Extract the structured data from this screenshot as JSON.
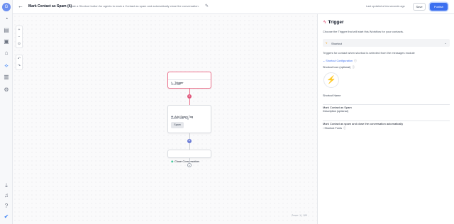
{
  "rail": {
    "logo_letter": "G",
    "icons": [
      "dashboard-icon",
      "conversations-icon",
      "contacts-icon",
      "opportunities-icon",
      "automation-icon",
      "reporting-icon",
      "settings-icon"
    ],
    "bottom_icons": [
      "download-icon",
      "notifications-icon",
      "help-icon",
      "profile-icon"
    ]
  },
  "header": {
    "title": "Mark Contact as Spam (4)",
    "description": "Create a Shortcut button for agents to mark a Contact as spam and automatically close the conversation.",
    "updated_text": "Last updated a few seconds ago",
    "save_label": "Save",
    "publish_label": "Publish"
  },
  "canvas": {
    "zoom_readout": "Zoom: 1 | 100",
    "controls": [
      "+",
      "−",
      "⊙",
      "↶",
      "↷"
    ],
    "nodes": {
      "trigger": {
        "title": "Trigger",
        "subtitle": "Shortcut"
      },
      "action": {
        "title": "Add Spam Tag",
        "subtitle": "Action: Add Tag",
        "chip": "Spam"
      },
      "close": {
        "title": "Close Conversation"
      }
    }
  },
  "panel": {
    "title": "Trigger",
    "description": "Choose the Trigger that will start this Workflow for your contacts.",
    "trigger_select_value": "Shortcut",
    "hint": "Triggers for contact when shortcut is selected from the messages module",
    "shortcut_config_label": "Shortcut Configuration",
    "shortcut_icon_label": "Shortcut Icon (optional)",
    "shortcut_name_label": "Shortcut Name",
    "shortcut_name_value": "Mark Contact as Spam",
    "description_label": "Description (optional)",
    "description_value": "Mark Contact as spam and close the conversation automatically",
    "shortcut_fonts_label": "Shortcut Fonts"
  },
  "colors": {
    "accent": "#3b6ff0",
    "trigger_border": "#ec6f8b",
    "bolt": "#f5c518"
  }
}
